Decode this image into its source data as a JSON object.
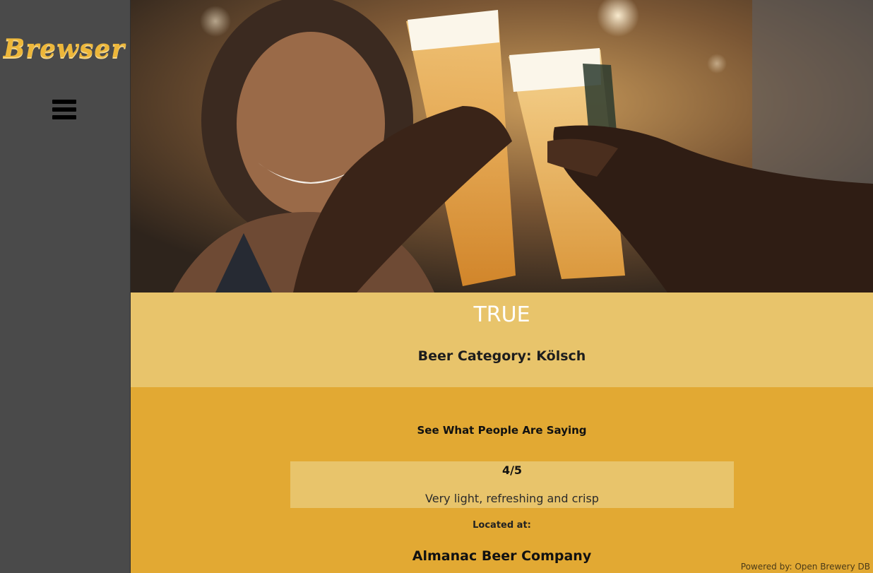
{
  "app": {
    "logo_text": "Brewser"
  },
  "menu": {
    "icon": "hamburger-menu-icon"
  },
  "hero": {
    "alt": "Friends toasting glasses of beer"
  },
  "beer": {
    "name": "TRUE",
    "category_label": "Beer Category: Kölsch"
  },
  "reviews": {
    "heading": "See What People Are Saying",
    "items": [
      {
        "rating": "4/5",
        "text": "Very light, refreshing and crisp"
      }
    ]
  },
  "location": {
    "label": "Located at:",
    "brewery_name": "Almanac Beer Company"
  },
  "footer": {
    "powered_by_prefix": "Powered by:",
    "powered_by_link": "Open Brewery DB"
  },
  "colors": {
    "sidebar": "#4A4A4A",
    "logo": "#EDB73A",
    "band_light": "#E8C46B",
    "band_dark": "#E2A933"
  }
}
